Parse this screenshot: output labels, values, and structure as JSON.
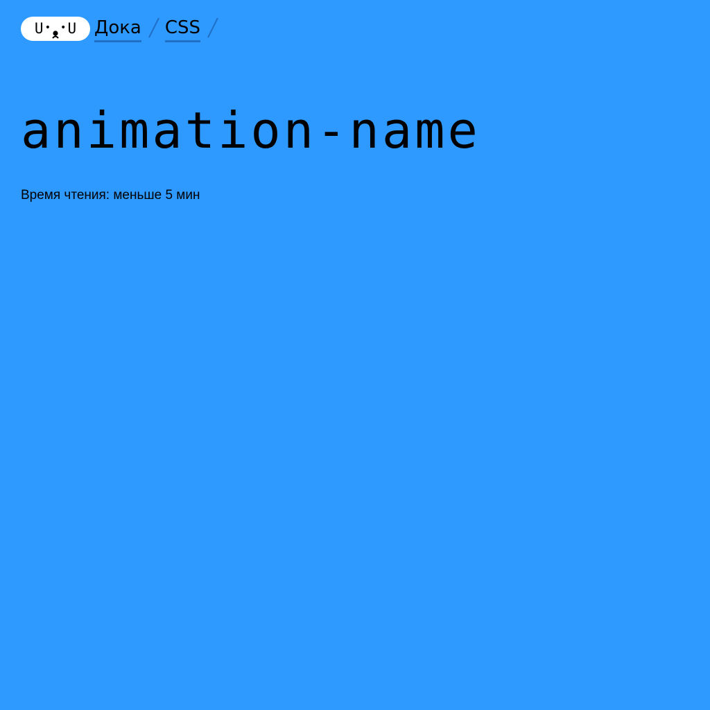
{
  "header": {
    "logo": {
      "left_letter": "U",
      "right_letter": "U"
    },
    "breadcrumbs": [
      {
        "label": "Дока"
      },
      {
        "label": "CSS"
      }
    ]
  },
  "article": {
    "title": "animation-name",
    "reading_time": "Время чтения: меньше 5 мин"
  },
  "colors": {
    "background": "#2e99ff",
    "text": "#000000",
    "link_underline": "#1f6fc4",
    "logo_background": "#ffffff"
  }
}
